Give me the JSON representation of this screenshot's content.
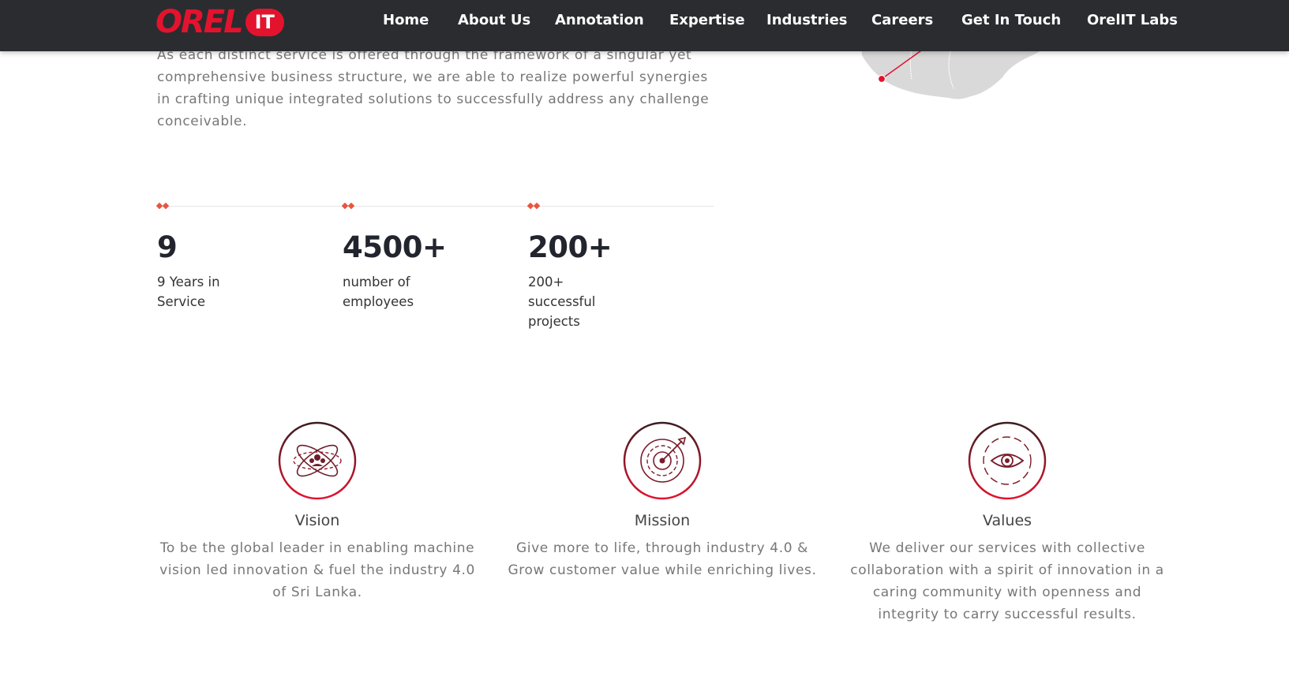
{
  "brand": {
    "logo_word": "OREL",
    "logo_badge": "IT",
    "accent_color": "#e3132e",
    "header_bg": "#2b2c30"
  },
  "nav": {
    "items": [
      {
        "label": "Home"
      },
      {
        "label": "About Us"
      },
      {
        "label": "Annotation"
      },
      {
        "label": "Expertise"
      },
      {
        "label": "Industries"
      },
      {
        "label": "Careers"
      },
      {
        "label": "Get In Touch"
      },
      {
        "label": "OrelIT Labs"
      }
    ]
  },
  "intro": {
    "text": "As each distinct service is offered through the framework of a singular yet comprehensive business structure, we are able to realize powerful synergies in crafting unique integrated solutions to successfully address any challenge conceivable."
  },
  "stats": [
    {
      "value": "9",
      "label": "9 Years in Service"
    },
    {
      "value": "4500+",
      "label": "number of employees"
    },
    {
      "value": "200+",
      "label": "200+ successful projects"
    }
  ],
  "pillars": [
    {
      "title": "Vision",
      "text": "To be the global leader in enabling machine vision led innovation & fuel the industry 4.0 of Sri Lanka.",
      "icon": "atom-people-icon"
    },
    {
      "title": "Mission",
      "text": "Give more to life, through industry 4.0 & Grow customer value while enriching lives.",
      "icon": "target-arrow-icon"
    },
    {
      "title": "Values",
      "text": "We deliver our services with collective collaboration with a spirit of innovation in a caring community with openness and integrity to carry successful results.",
      "icon": "eye-icon"
    }
  ]
}
